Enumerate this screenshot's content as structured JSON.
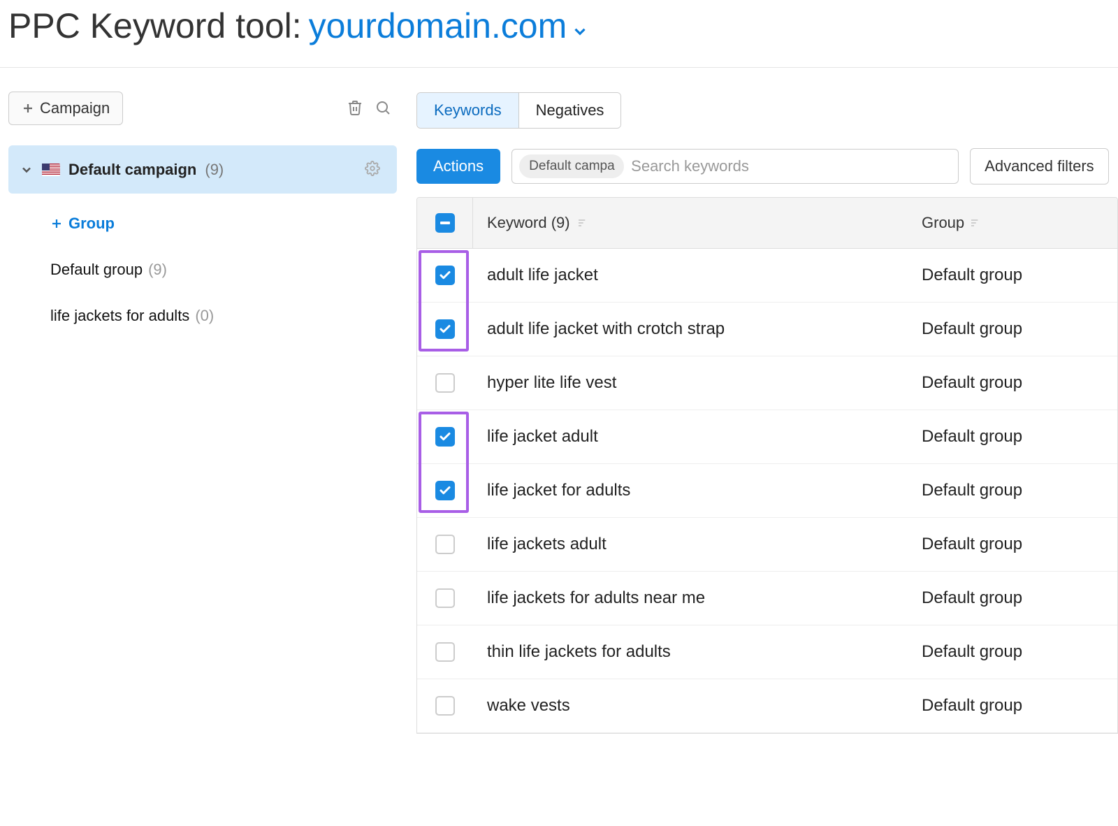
{
  "header": {
    "title_prefix": "PPC Keyword tool:",
    "domain": "yourdomain.com"
  },
  "sidebar": {
    "add_campaign": "Campaign",
    "campaign_label": "Default campaign",
    "campaign_count": "(9)",
    "add_group": "Group",
    "groups": [
      {
        "label": "Default group",
        "count": "(9)"
      },
      {
        "label": "life jackets for adults",
        "count": "(0)"
      }
    ]
  },
  "tabs": {
    "t0": "Keywords",
    "t1": "Negatives"
  },
  "filters": {
    "actions": "Actions",
    "chip": "Default campa",
    "search_placeholder": "Search keywords",
    "advanced": "Advanced filters"
  },
  "table": {
    "keyword_header": "Keyword (9)",
    "group_header": "Group",
    "rows": [
      {
        "checked": true,
        "keyword": "adult life jacket",
        "group": "Default group",
        "highlight": true
      },
      {
        "checked": true,
        "keyword": "adult life jacket with crotch strap",
        "group": "Default group",
        "highlight": true
      },
      {
        "checked": false,
        "keyword": "hyper lite life vest",
        "group": "Default group",
        "highlight": false
      },
      {
        "checked": true,
        "keyword": "life jacket adult",
        "group": "Default group",
        "highlight": true
      },
      {
        "checked": true,
        "keyword": "life jacket for adults",
        "group": "Default group",
        "highlight": true
      },
      {
        "checked": false,
        "keyword": "life jackets adult",
        "group": "Default group",
        "highlight": false
      },
      {
        "checked": false,
        "keyword": "life jackets for adults near me",
        "group": "Default group",
        "highlight": false
      },
      {
        "checked": false,
        "keyword": "thin life jackets for adults",
        "group": "Default group",
        "highlight": false
      },
      {
        "checked": false,
        "keyword": "wake vests",
        "group": "Default group",
        "highlight": false
      }
    ]
  }
}
